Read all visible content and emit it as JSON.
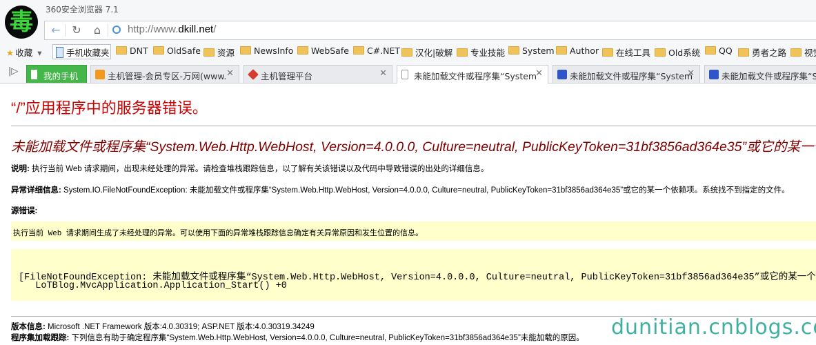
{
  "app_title": "360安全浏览器 7.1",
  "logo_char": "毒",
  "address": {
    "url_prefix": "http://www.",
    "url_domain": "dkill.net",
    "url_suffix": "/"
  },
  "bookmarks": [
    {
      "label": "收藏",
      "type": "star"
    },
    {
      "label": "手机收藏夹",
      "type": "phone"
    },
    {
      "label": "DNT",
      "type": "folder"
    },
    {
      "label": "OldSafe",
      "type": "folder"
    },
    {
      "label": "资源",
      "type": "folder"
    },
    {
      "label": "NewsInfo",
      "type": "folder"
    },
    {
      "label": "WebSafe",
      "type": "folder"
    },
    {
      "label": "C#.NET",
      "type": "folder"
    },
    {
      "label": "汉化|破解",
      "type": "folder"
    },
    {
      "label": "专业技能",
      "type": "folder"
    },
    {
      "label": "System",
      "type": "folder"
    },
    {
      "label": "Author",
      "type": "folder"
    },
    {
      "label": "在线工具",
      "type": "folder"
    },
    {
      "label": "Old系统",
      "type": "folder"
    },
    {
      "label": "QQ",
      "type": "folder"
    },
    {
      "label": "勇者之路",
      "type": "folder"
    },
    {
      "label": "视觉",
      "type": "folder"
    }
  ],
  "tabs": [
    {
      "label": "我的手机"
    },
    {
      "label": "主机管理-会员专区-万网(www."
    },
    {
      "label": "主机管理平台"
    },
    {
      "label": "未能加载文件或程序集“System"
    },
    {
      "label": "未能加载文件或程序集“System"
    },
    {
      "label": "未能加载文件或程序集“System"
    }
  ],
  "page": {
    "title": "“/”应用程序中的服务器错误。",
    "subtitle": "未能加载文件或程序集“System.Web.Http.WebHost, Version=4.0.0.0, Culture=neutral, PublicKeyToken=31bf3856ad364e35”或它的某一个依赖项。",
    "description_label": "说明:",
    "description_text": " 执行当前 Web 请求期间，出现未经处理的异常。请检查堆栈跟踪信息，以了解有关该错误以及代码中导致错误的出处的详细信息。",
    "exception_label": "异常详细信息:",
    "exception_text": " System.IO.FileNotFoundException: 未能加载文件或程序集“System.Web.Http.WebHost, Version=4.0.0.0, Culture=neutral, PublicKeyToken=31bf3856ad364e35”或它的某一个依赖项。系统找不到指定的文件。",
    "source_label": "源错误:",
    "source_text": "执行当前 Web 请求期间生成了未经处理的异常。可以使用下面的异常堆栈跟踪信息确定有关异常原因和发生位置的信息。",
    "stack_line1": "[FileNotFoundException: 未能加载文件或程序集“System.Web.Http.WebHost, Version=4.0.0.0, Culture=neutral, PublicKeyToken=31bf3856ad364e35”或它的某一个依赖项。系统找不到指定的文件。]",
    "stack_line2": "   LoTBlog.MvcApplication.Application_Start() +0",
    "version_label": "版本信息:",
    "version_text": " Microsoft .NET Framework 版本:4.0.30319; ASP.NET 版本:4.0.30319.34249",
    "assembly_label": "程序集加载跟踪:",
    "assembly_text": " 下列信息有助于确定程序集“System.Web.Http.WebHost, Version=4.0.0.0, Culture=neutral, PublicKeyToken=31bf3856ad364e35”未能加载的原因。"
  },
  "watermark": "dunitian.cnblogs.com",
  "colors": {
    "error_title": "#cc0000",
    "subtitle": "#800000",
    "highlight_bg": "#ffffcc",
    "active_tab_green": "#45b649",
    "watermark": "#3fb0a0"
  }
}
